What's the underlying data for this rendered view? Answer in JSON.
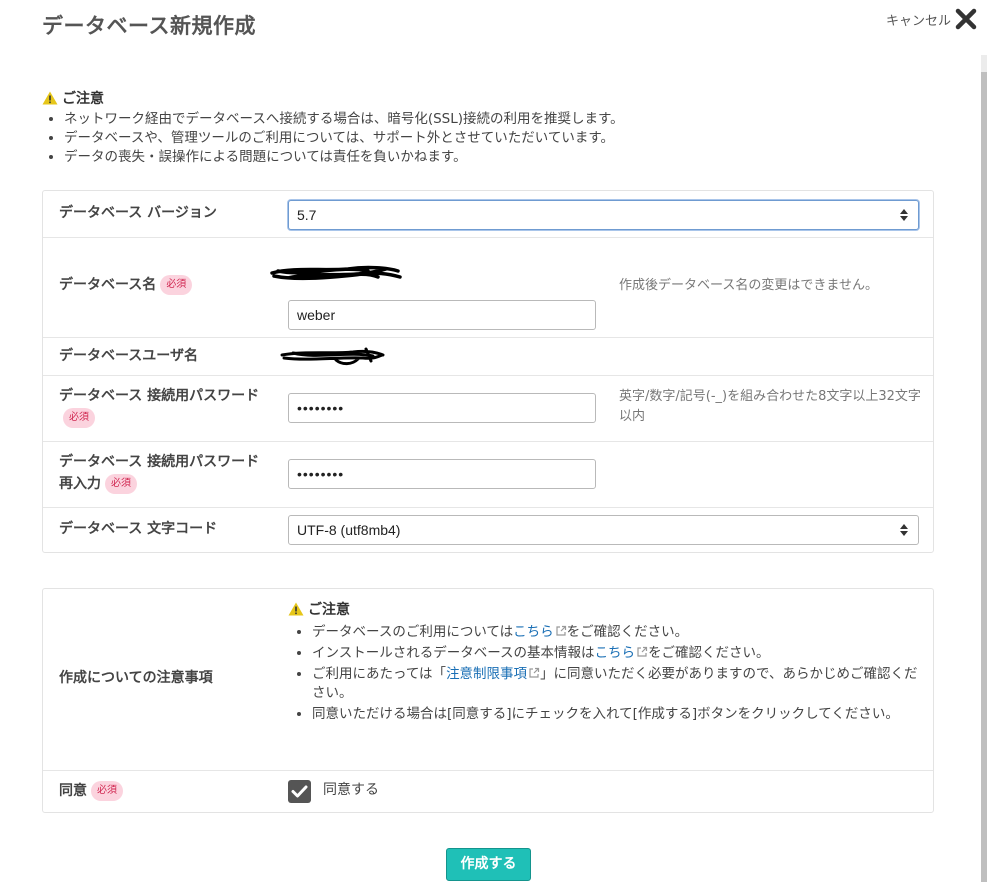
{
  "header": {
    "title": "データベース新規作成",
    "cancel_label": "キャンセル"
  },
  "notice": {
    "title": "ご注意",
    "items": [
      "ネットワーク経由でデータベースへ接続する場合は、暗号化(SSL)接続の利用を推奨します。",
      "データベースや、管理ツールのご利用については、サポート外とさせていただいています。",
      "データの喪失・誤操作による問題については責任を負いかねます。"
    ]
  },
  "form": {
    "required_badge": "必須",
    "version": {
      "label": "データベース バージョン",
      "value": "5.7"
    },
    "db_name": {
      "label": "データベース名",
      "value": "weber",
      "hint": "作成後データベース名の変更はできません。"
    },
    "db_user": {
      "label": "データベースユーザ名"
    },
    "password": {
      "label": "データベース 接続用パスワード",
      "value": "••••••••",
      "hint": "英字/数字/記号(-_)を組み合わせた8文字以上32文字以内"
    },
    "password_confirm": {
      "label": "データベース 接続用パスワード再入力",
      "value": "••••••••"
    },
    "charset": {
      "label": "データベース 文字コード",
      "value": "UTF-8 (utf8mb4)"
    }
  },
  "terms": {
    "label": "作成についての注意事項",
    "notice_title": "ご注意",
    "item1_pre": "データベースのご利用については",
    "item1_link": "こちら",
    "item1_post": "をご確認ください。",
    "item2_pre": "インストールされるデータベースの基本情報は",
    "item2_link": "こちら",
    "item2_post": "をご確認ください。",
    "item3_pre": "ご利用にあたっては「",
    "item3_link": "注意制限事項",
    "item3_post": "」に同意いただく必要がありますので、あらかじめご確認ください。",
    "item4": "同意いただける場合は[同意する]にチェックを入れて[作成する]ボタンをクリックしてください。"
  },
  "agree": {
    "label": "同意",
    "checkbox_label": "同意する",
    "checked": true
  },
  "submit_label": "作成する",
  "colors": {
    "accent": "#1fc0b7",
    "link": "#1a6fb5",
    "required_bg": "#fbd3de",
    "required_text": "#d02650",
    "warning": "#e6c619"
  }
}
